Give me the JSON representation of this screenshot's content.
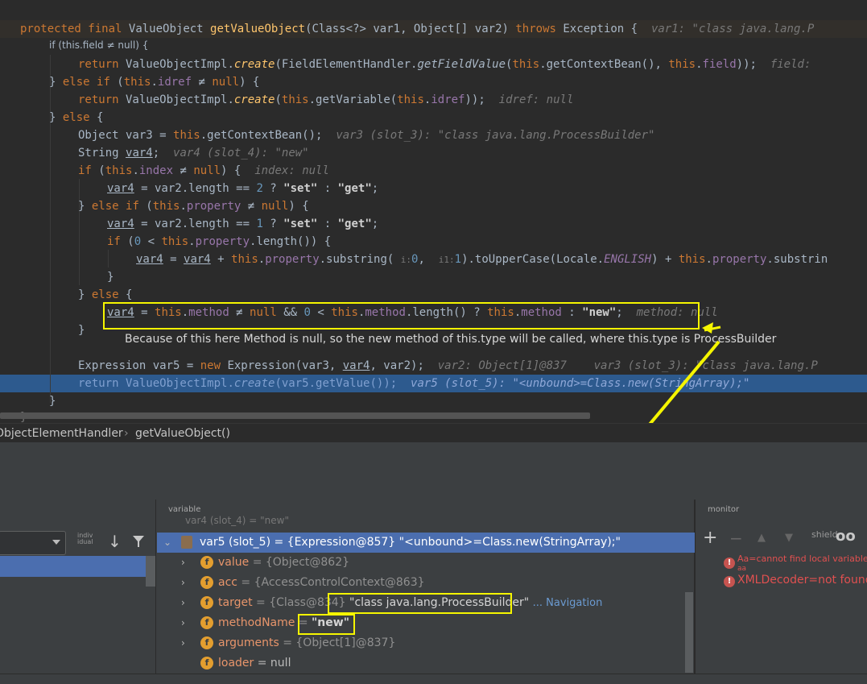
{
  "editor": {
    "header_fragments": {
      "kw_protected": "protected",
      "kw_final": "final",
      "type_valueobject": "ValueObject",
      "method_name": "getValueObject",
      "params_part1": "(Class<?> var1, Object[] var2) ",
      "kw_throws": "throws",
      "exception": " Exception {",
      "hint": "var1: \"class java.lang.P"
    },
    "collapsed_line": "if (this.field ≠ null) {",
    "lines": {
      "l3": {
        "return": "return",
        "a": " ValueObjectImpl.",
        "create": "create",
        "b": "(FieldElementHandler.",
        "getfield": "getFieldValue",
        "c": "(",
        "this1": "this",
        "d": ".getContextBean(), ",
        "this2": "this",
        "e": ".",
        "field": "field",
        "f": "));",
        "hint": "field:"
      },
      "l4": {
        "brace": "} ",
        "else": "else",
        "sp": " ",
        "if": "if",
        "a": " (",
        "this": "this",
        "b": ".",
        "idref": "idref",
        "c": " ≠ ",
        "null": "null",
        "d": ") {"
      },
      "l5": {
        "return": "return",
        "a": " ValueObjectImpl.",
        "create": "create",
        "b": "(",
        "this1": "this",
        "c": ".getVariable(",
        "this2": "this",
        "d": ".",
        "idref": "idref",
        "e": "));",
        "hint": "idref: null"
      },
      "l6": {
        "brace": "} ",
        "else": "else",
        "b": " {"
      },
      "l7": {
        "a": "Object var3 = ",
        "this": "this",
        "b": ".getContextBean();",
        "hint": "var3 (slot_3): \"class java.lang.ProcessBuilder\""
      },
      "l8": {
        "a": "String ",
        "var4": "var4",
        "b": ";",
        "hint": "var4 (slot_4): \"new\""
      },
      "l9": {
        "if": "if",
        "a": " (",
        "this": "this",
        "b": ".",
        "index": "index",
        "c": " ≠ ",
        "null": "null",
        "d": ") {",
        "hint": "index: null"
      },
      "l10": {
        "var4": "var4",
        "a": " = var2.length == ",
        "two": "2",
        "b": " ? ",
        "set": "\"set\"",
        "c": " : ",
        "get": "\"get\"",
        "d": ";"
      },
      "l11": {
        "brace": "} ",
        "else": "else",
        "sp": " ",
        "if": "if",
        "a": " (",
        "this": "this",
        "b": ".",
        "property": "property",
        "c": " ≠ ",
        "null": "null",
        "d": ") {"
      },
      "l12": {
        "var4": "var4",
        "a": " = var2.length == ",
        "one": "1",
        "b": " ? ",
        "set": "\"set\"",
        "c": " : ",
        "get": "\"get\"",
        "d": ";"
      },
      "l13": {
        "if": "if",
        "a": " (",
        "zero": "0",
        "b": " < ",
        "this": "this",
        "c": ".",
        "property": "property",
        "d": ".length()) {"
      },
      "l14": {
        "var4a": "var4",
        "a": " = ",
        "var4b": "var4",
        "b": " + ",
        "this1": "this",
        "c": ".",
        "property1": "property",
        "d": ".substring( ",
        "i0": "i:",
        "zero": "0",
        "e": ",  ",
        "i1": "i1:",
        "one": "1",
        "f": ").toUpperCase(Locale.",
        "english": "ENGLISH",
        "g": ") + ",
        "this2": "this",
        "h": ".",
        "property2": "property",
        "i": ".substrin"
      },
      "l15": {
        "brace": "}"
      },
      "l16": {
        "brace": "} ",
        "else": "else",
        "b": " {"
      },
      "l17": {
        "var4": "var4",
        "a": " = ",
        "this1": "this",
        "b": ".",
        "method1": "method",
        "c": " ≠ ",
        "null": "null",
        "d": " && ",
        "zero": "0",
        "e": " < ",
        "this2": "this",
        "f": ".",
        "method2": "method",
        "g": ".length() ? ",
        "this3": "this",
        "h": ".",
        "method3": "method",
        "i": " : ",
        "new": "\"new\"",
        "j": ";",
        "hint": "method: null"
      },
      "l18": {
        "brace": "}"
      },
      "annotation": "Because of this here Method is null, so the new method of this.type will be called, where this.type is ProcessBuilder",
      "l20": {
        "a": "Expression var5 = ",
        "new": "new",
        "b": " Expression(var3, ",
        "var4": "var4",
        "c": ", var2);",
        "hint1": "var2: Object[1]@837",
        "hint2": "var3 (slot_3): \"class java.lang.P"
      },
      "l21": {
        "return": "return",
        "a": " ValueObjectImpl.",
        "create": "create",
        "b": "(var5.getValue());",
        "hint": "var5 (slot_5): \"<unbound>=Class.new(StringArray);\""
      },
      "l22": {
        "brace": "}"
      },
      "l23": {
        "brace": "}"
      }
    }
  },
  "breadcrumb": {
    "class_name": "ObjectElementHandler",
    "separator": "›",
    "method_name": "getValueObject()"
  },
  "debugger": {
    "variables_header": "variable",
    "monitor_header": "monitor",
    "individual_label_1": "indiv",
    "individual_label_2": "idual",
    "partial_row": "var4 (slot_4) = \"new\"",
    "tree": [
      {
        "name": "var5 (slot_5)",
        "ref": " = {Expression@857} ",
        "value": "\"<unbound>=Class.new(StringArray);\""
      },
      {
        "name": "value",
        "ref": " = {Object@862}"
      },
      {
        "name": "acc",
        "ref": " = {AccessControlContext@863}"
      },
      {
        "name": "target",
        "ref": " = {Class@834}",
        "value": "\"class java.lang.ProcessBuilder\"",
        "extra": "... Navigation"
      },
      {
        "name": "methodName",
        "ref": " = ",
        "value": "\"new\""
      },
      {
        "name": "arguments",
        "ref": " = {Object[1]@837}"
      },
      {
        "name": "loader",
        "ref": " = null"
      }
    ],
    "monitor_toolbar": {
      "add": "+",
      "remove": "−",
      "up": "▲",
      "down": "▼",
      "shield_label": "shield",
      "glasses": "oo"
    },
    "monitor_items": [
      {
        "text": "Aa=cannot find local variable 'aa'",
        "sub": "aa"
      },
      {
        "text": "XMLDecoder=not found"
      }
    ]
  },
  "colors": {
    "highlight": "#f5f500",
    "selection": "#4b6eaf",
    "keyword": "#cc7832",
    "method": "#ffc66d",
    "field": "#9876aa"
  },
  "icons": [
    "down-arrow-icon",
    "filter-icon",
    "expand-caret-icon",
    "field-icon",
    "error-icon",
    "add-icon",
    "remove-icon",
    "move-up-icon",
    "move-down-icon",
    "glasses-icon"
  ]
}
